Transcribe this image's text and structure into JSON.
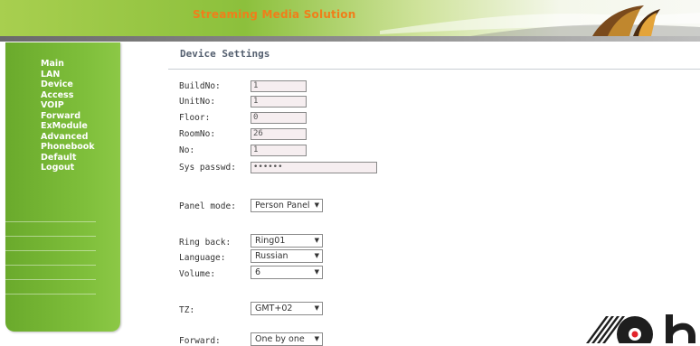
{
  "header": {
    "title": "Streaming Media Solution"
  },
  "sidebar": {
    "items": [
      {
        "label": "Main"
      },
      {
        "label": "LAN"
      },
      {
        "label": "Device"
      },
      {
        "label": "Access"
      },
      {
        "label": "VOIP"
      },
      {
        "label": "Forward"
      },
      {
        "label": "ExModule"
      },
      {
        "label": "Advanced"
      },
      {
        "label": "Phonebook"
      },
      {
        "label": "Default"
      },
      {
        "label": "Logout"
      }
    ]
  },
  "main": {
    "title": "Device Settings",
    "fields": {
      "build_no": {
        "label": "BuildNo:",
        "value": "1"
      },
      "unit_no": {
        "label": "UnitNo:",
        "value": "1"
      },
      "floor": {
        "label": "Floor:",
        "value": "0"
      },
      "room_no": {
        "label": "RoomNo:",
        "value": "26"
      },
      "no": {
        "label": "No:",
        "value": "1"
      },
      "sys_passwd": {
        "label": "Sys passwd:",
        "value": "••••••"
      }
    },
    "selects": {
      "panel_mode": {
        "label": "Panel mode:",
        "value": "Person Panel"
      },
      "ring_back": {
        "label": "Ring back:",
        "value": "Ring01"
      },
      "language": {
        "label": "Language:",
        "value": "Russian"
      },
      "volume": {
        "label": "Volume:",
        "value": "6"
      },
      "tz": {
        "label": "TZ:",
        "value": "GMT+02"
      },
      "forward": {
        "label": "Forward:",
        "value": "One by one"
      }
    }
  },
  "colors": {
    "banner_green": "#8cc03c",
    "banner_title": "#f07e1a",
    "sidebar_green": "#7fbf3b",
    "field_bg": "#f6eef0"
  },
  "icons": {
    "dropdown": "chevron-down-icon",
    "watermark": "record-logo-icon"
  }
}
